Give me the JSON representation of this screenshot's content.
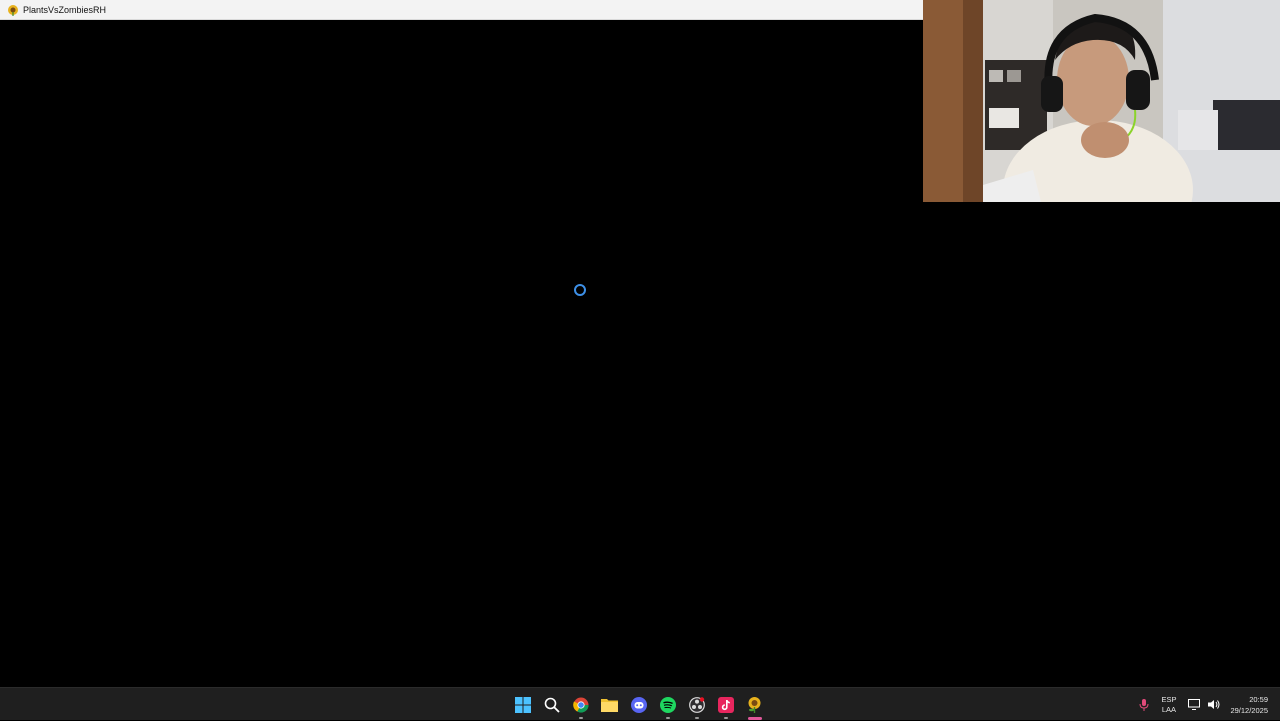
{
  "window": {
    "title": "PlantsVsZombiesRH",
    "icon": "sunflower-zombie-icon"
  },
  "game": {
    "state": "loading",
    "spinner_color": "#3d8fe6",
    "background": "#000000"
  },
  "webcam": {
    "content": "streamer-webcam-feed"
  },
  "taskbar": {
    "apps": [
      {
        "name": "start",
        "icon": "windows-start-icon"
      },
      {
        "name": "search",
        "icon": "search-icon"
      },
      {
        "name": "chrome",
        "icon": "chrome-icon",
        "running": true
      },
      {
        "name": "file-explorer",
        "icon": "folder-icon"
      },
      {
        "name": "discord",
        "icon": "discord-icon"
      },
      {
        "name": "spotify",
        "icon": "spotify-icon",
        "running": true
      },
      {
        "name": "obs",
        "icon": "obs-icon",
        "running": true
      },
      {
        "name": "tiktok-live",
        "icon": "tiktok-icon",
        "running": true
      },
      {
        "name": "plants-vs-zombies",
        "icon": "sunflower-zombie-icon",
        "active": true
      }
    ],
    "tray": {
      "lang_primary": "ESP",
      "lang_secondary": "LAA",
      "time": "20:59",
      "date": "29/12/2025"
    }
  }
}
